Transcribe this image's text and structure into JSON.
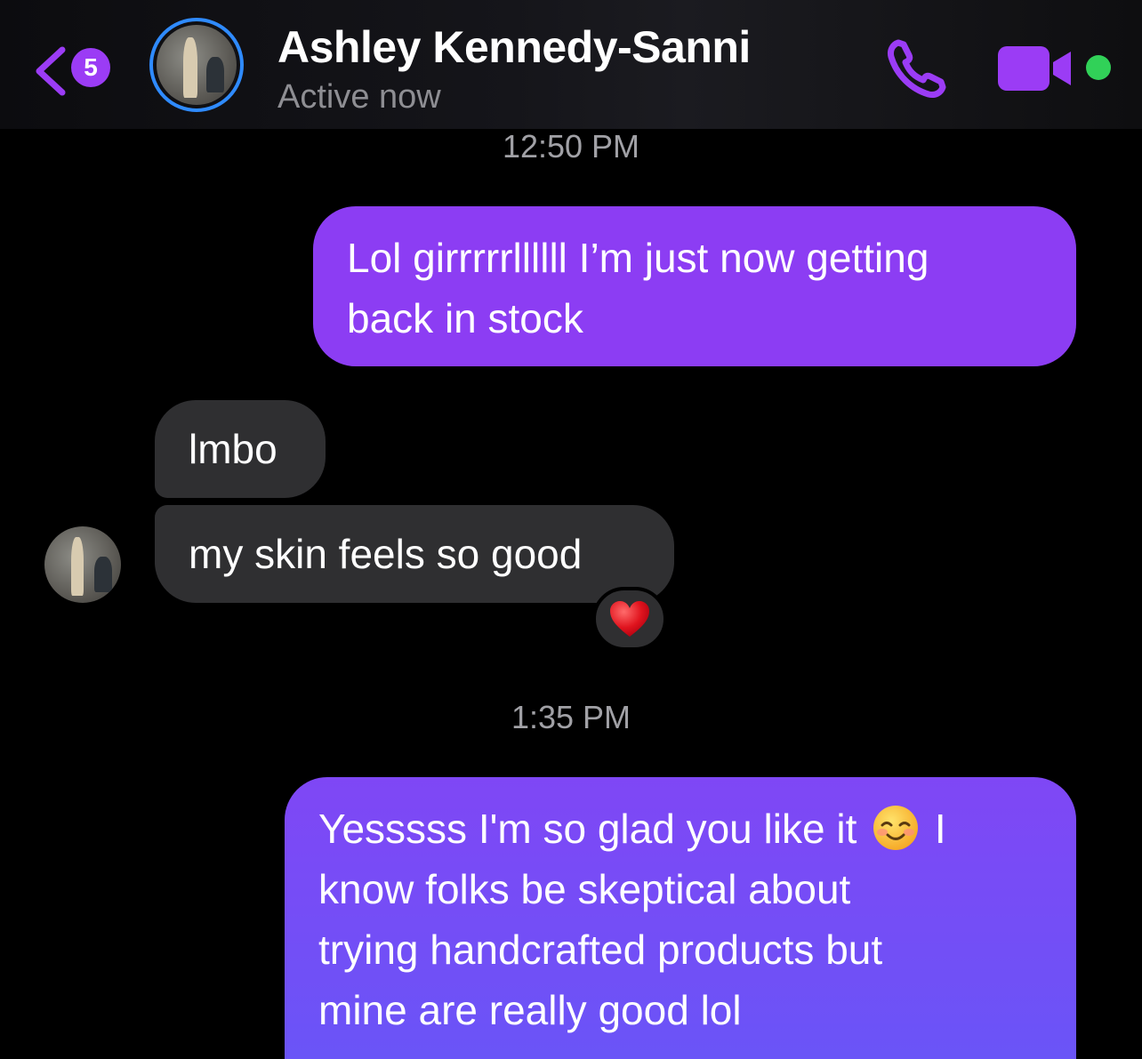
{
  "header": {
    "back_badge_count": "5",
    "contact_name": "Ashley Kennedy-Sanni",
    "status": "Active now",
    "icons": [
      "chevron-left-icon",
      "phone-icon",
      "video-camera-icon"
    ],
    "online_color": "#31d158",
    "accent_color": "#9b3cf5"
  },
  "messages": {
    "timestamp_1": "12:50 PM",
    "out_1_lines": [
      "Lol girrrrrllllll I’m just now getting",
      "back in stock"
    ],
    "in_1": "lmbo",
    "in_2": "my skin feels so good",
    "reaction": "heart",
    "timestamp_2": "1:35 PM",
    "out_2": {
      "line1_before_emoji": "Yesssss I'm so glad you like it",
      "emoji": "smiling-face-icon",
      "line1_after_emoji": "I",
      "lines": [
        "know folks be skeptical about",
        "trying handcrafted products but",
        "mine are really good lol"
      ]
    }
  },
  "colors": {
    "outgoing_bubble": "#8c3df3",
    "incoming_bubble": "#2f2f31"
  }
}
